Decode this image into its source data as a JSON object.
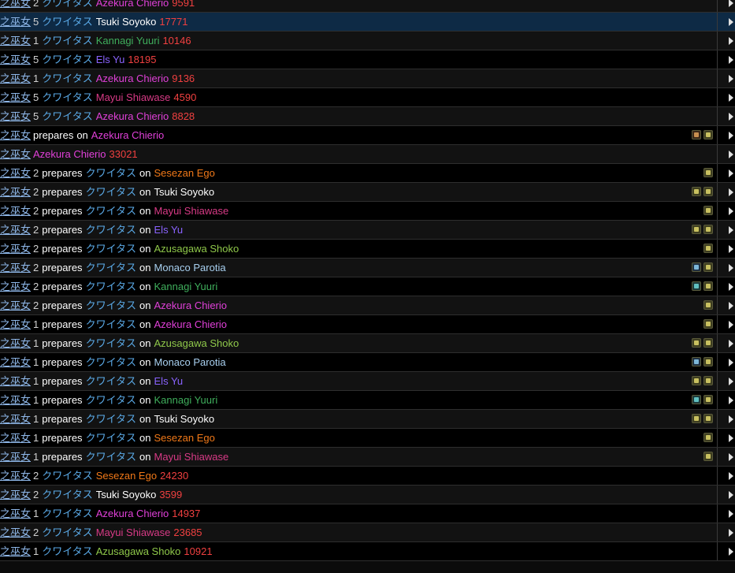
{
  "colors": {
    "Azekura Chierio": "#e040d8",
    "Tsuki Soyoko": "#ffffff",
    "Kannagi Yuuri": "#3fae5c",
    "Els Yu": "#8a63ff",
    "Mayui Shiawase": "#d83a86",
    "Sesezan Ego": "#f07818",
    "Azusagawa Shoko": "#8fc84a",
    "Monaco Parotia": "#a8d0f0",
    "amount": "#f04040"
  },
  "labels": {
    "actor": "燐之巫女",
    "skill": "クワイタス",
    "prepares": "prepares",
    "on": "on"
  },
  "rows": [
    {
      "type": "hit",
      "num": "2",
      "target": "Azekura Chierio",
      "amount": "9591",
      "icons": []
    },
    {
      "type": "hit",
      "num": "5",
      "target": "Tsuki Soyoko",
      "amount": "17771",
      "icons": [],
      "selected": true
    },
    {
      "type": "hit",
      "num": "1",
      "target": "Kannagi Yuuri",
      "amount": "10146",
      "icons": []
    },
    {
      "type": "hit",
      "num": "5",
      "target": "Els Yu",
      "amount": "18195",
      "icons": []
    },
    {
      "type": "hit",
      "num": "1",
      "target": "Azekura Chierio",
      "amount": "9136",
      "icons": []
    },
    {
      "type": "hit",
      "num": "5",
      "target": "Mayui Shiawase",
      "amount": "4590",
      "icons": []
    },
    {
      "type": "hit",
      "num": "5",
      "target": "Azekura Chierio",
      "amount": "8828",
      "icons": []
    },
    {
      "type": "prep0",
      "target": "Azekura Chierio",
      "icons": [
        "brown",
        "yellow"
      ]
    },
    {
      "type": "hit0",
      "target": "Azekura Chierio",
      "amount": "33021",
      "icons": []
    },
    {
      "type": "prep",
      "num": "2",
      "target": "Sesezan Ego",
      "icons": [
        "yellow"
      ]
    },
    {
      "type": "prep",
      "num": "2",
      "target": "Tsuki Soyoko",
      "icons": [
        "yellow",
        "yellow"
      ]
    },
    {
      "type": "prep",
      "num": "2",
      "target": "Mayui Shiawase",
      "icons": [
        "yellow"
      ]
    },
    {
      "type": "prep",
      "num": "2",
      "target": "Els Yu",
      "icons": [
        "yellow",
        "yellow"
      ]
    },
    {
      "type": "prep",
      "num": "2",
      "target": "Azusagawa Shoko",
      "icons": [
        "yellow"
      ]
    },
    {
      "type": "prep",
      "num": "2",
      "target": "Monaco Parotia",
      "icons": [
        "blue",
        "yellow"
      ]
    },
    {
      "type": "prep",
      "num": "2",
      "target": "Kannagi Yuuri",
      "icons": [
        "teal",
        "yellow"
      ]
    },
    {
      "type": "prep",
      "num": "2",
      "target": "Azekura Chierio",
      "icons": [
        "yellow"
      ]
    },
    {
      "type": "prep",
      "num": "1",
      "target": "Azekura Chierio",
      "icons": [
        "yellow"
      ]
    },
    {
      "type": "prep",
      "num": "1",
      "target": "Azusagawa Shoko",
      "icons": [
        "yellow",
        "yellow"
      ]
    },
    {
      "type": "prep",
      "num": "1",
      "target": "Monaco Parotia",
      "icons": [
        "blue",
        "yellow"
      ]
    },
    {
      "type": "prep",
      "num": "1",
      "target": "Els Yu",
      "icons": [
        "yellow",
        "yellow"
      ]
    },
    {
      "type": "prep",
      "num": "1",
      "target": "Kannagi Yuuri",
      "icons": [
        "teal",
        "yellow"
      ]
    },
    {
      "type": "prep",
      "num": "1",
      "target": "Tsuki Soyoko",
      "icons": [
        "yellow",
        "yellow"
      ]
    },
    {
      "type": "prep",
      "num": "1",
      "target": "Sesezan Ego",
      "icons": [
        "yellow"
      ]
    },
    {
      "type": "prep",
      "num": "1",
      "target": "Mayui Shiawase",
      "icons": [
        "yellow"
      ]
    },
    {
      "type": "hit",
      "num": "2",
      "target": "Sesezan Ego",
      "amount": "24230",
      "icons": []
    },
    {
      "type": "hit",
      "num": "2",
      "target": "Tsuki Soyoko",
      "amount": "3599",
      "icons": []
    },
    {
      "type": "hit",
      "num": "1",
      "target": "Azekura Chierio",
      "amount": "14937",
      "icons": []
    },
    {
      "type": "hit",
      "num": "2",
      "target": "Mayui Shiawase",
      "amount": "23685",
      "icons": []
    },
    {
      "type": "hit",
      "num": "1",
      "target": "Azusagawa Shoko",
      "amount": "10921",
      "icons": []
    }
  ]
}
